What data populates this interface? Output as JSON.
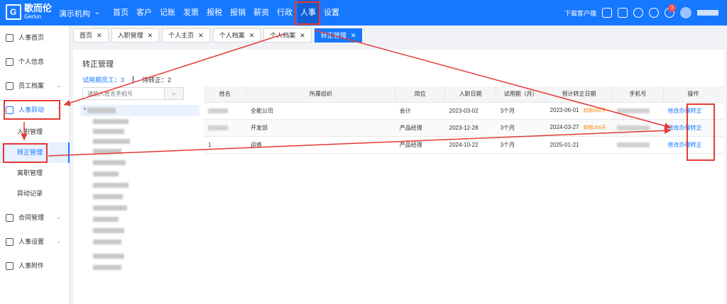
{
  "app": {
    "logo_text": "歌而伦",
    "logo_sub": "Gerlun",
    "org": "演示机构",
    "menu": [
      "首页",
      "客户",
      "记账",
      "发票",
      "报税",
      "报销",
      "薪资",
      "行政",
      "人事",
      "设置"
    ],
    "download": "下载客户端",
    "badge": "3"
  },
  "sidebar": {
    "items": [
      "人事首页",
      "个人信息",
      "员工档案",
      "人事异动",
      "合同管理",
      "人事设置",
      "人事附件"
    ],
    "sub_items": [
      "入职管理",
      "转正管理",
      "离职管理",
      "异动记录"
    ]
  },
  "tabs": [
    "首页",
    "入职管理",
    "个人主页",
    "个人档案",
    "个人档案",
    "转正管理"
  ],
  "page": {
    "title": "转正管理",
    "stat_probation": "试用期员工：3",
    "stat_pending": "待转正：2",
    "search_placeholder": "请输入姓名手机号"
  },
  "table": {
    "headers": [
      "姓名",
      "所属组织",
      "岗位",
      "入职日期",
      "试用期（月）",
      "预计转正日期",
      "手机号",
      "操作"
    ],
    "rows": [
      {
        "name": "",
        "org": "全能公司",
        "post": "会计",
        "join": "2023-03-02",
        "period": "3个月",
        "expected": "2023-06-01",
        "overdue": "超期566天",
        "op_edit": "修改",
        "op_regular": "办理转正"
      },
      {
        "name": "",
        "org": "开发部",
        "post": "产品经理",
        "join": "2023-12-28",
        "period": "3个月",
        "expected": "2024-03-27",
        "overdue": "超期266天",
        "op_edit": "修改",
        "op_regular": "办理转正"
      },
      {
        "name": "1",
        "org": "运维",
        "post": "产品经理",
        "join": "2024-10-22",
        "period": "3个月",
        "expected": "2025-01-21",
        "overdue": "",
        "op_edit": "修改",
        "op_regular": "办理转正"
      }
    ]
  }
}
